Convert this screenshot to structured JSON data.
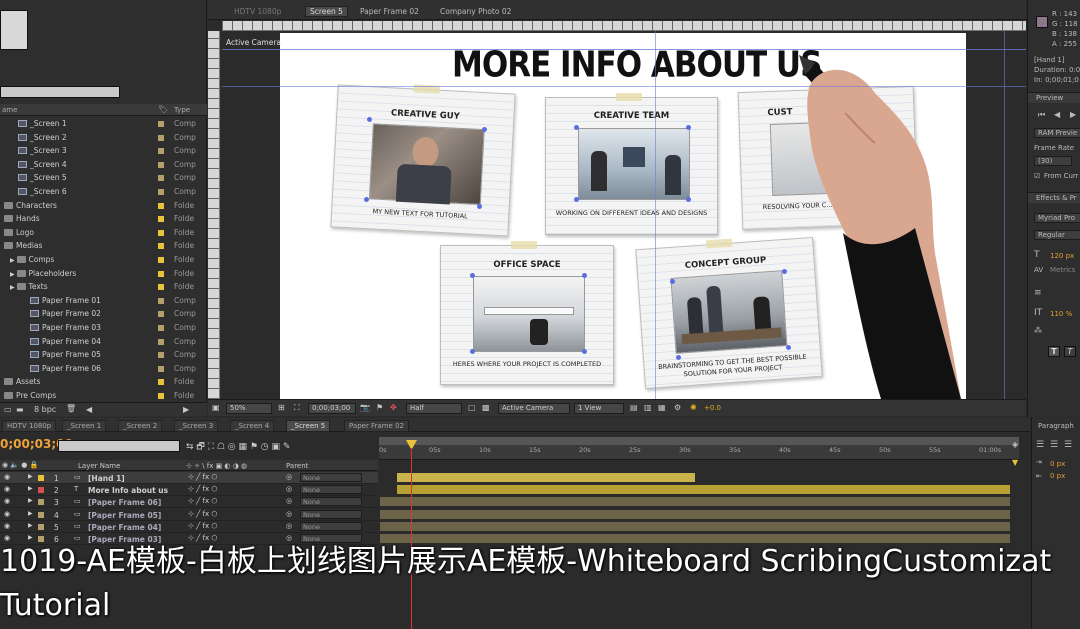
{
  "project": {
    "search_placeholder": "",
    "col_name": "ame",
    "col_type": "Type",
    "footer_bpc": "8 bpc",
    "items": [
      {
        "label": "_Screen 1",
        "kind": "comp",
        "indent": 2,
        "type": "Comp",
        "color": "#b3a06a"
      },
      {
        "label": "_Screen 2",
        "kind": "comp",
        "indent": 2,
        "type": "Comp",
        "color": "#b3a06a"
      },
      {
        "label": "_Screen 3",
        "kind": "comp",
        "indent": 2,
        "type": "Comp",
        "color": "#b3a06a"
      },
      {
        "label": "_Screen 4",
        "kind": "comp",
        "indent": 2,
        "type": "Comp",
        "color": "#b3a06a"
      },
      {
        "label": "_Screen 5",
        "kind": "comp",
        "indent": 2,
        "type": "Comp",
        "color": "#b3a06a"
      },
      {
        "label": "_Screen 6",
        "kind": "comp",
        "indent": 2,
        "type": "Comp",
        "color": "#b3a06a"
      },
      {
        "label": "Characters",
        "kind": "folder",
        "indent": 0,
        "type": "Folde",
        "color": "#e8c23a"
      },
      {
        "label": "Hands",
        "kind": "folder",
        "indent": 0,
        "type": "Folde",
        "color": "#e8c23a"
      },
      {
        "label": "Logo",
        "kind": "folder",
        "indent": 0,
        "type": "Folde",
        "color": "#e8c23a"
      },
      {
        "label": "Medias",
        "kind": "folder",
        "indent": 0,
        "type": "Folde",
        "color": "#e8c23a"
      },
      {
        "label": "Comps",
        "kind": "folder",
        "indent": 1,
        "type": "Folde",
        "color": "#e8c23a"
      },
      {
        "label": "Placeholders",
        "kind": "folder",
        "indent": 1,
        "type": "Folde",
        "color": "#e8c23a"
      },
      {
        "label": "Texts",
        "kind": "folder",
        "indent": 1,
        "type": "Folde",
        "color": "#e8c23a"
      },
      {
        "label": "Paper Frame 01",
        "kind": "comp",
        "indent": 3,
        "type": "Comp",
        "color": "#b3a06a"
      },
      {
        "label": "Paper Frame 02",
        "kind": "comp",
        "indent": 3,
        "type": "Comp",
        "color": "#b3a06a"
      },
      {
        "label": "Paper Frame 03",
        "kind": "comp",
        "indent": 3,
        "type": "Comp",
        "color": "#b3a06a"
      },
      {
        "label": "Paper Frame 04",
        "kind": "comp",
        "indent": 3,
        "type": "Comp",
        "color": "#b3a06a"
      },
      {
        "label": "Paper Frame 05",
        "kind": "comp",
        "indent": 3,
        "type": "Comp",
        "color": "#b3a06a"
      },
      {
        "label": "Paper Frame 06",
        "kind": "comp",
        "indent": 3,
        "type": "Comp",
        "color": "#b3a06a"
      },
      {
        "label": "Assets",
        "kind": "folder",
        "indent": 0,
        "type": "Folde",
        "color": "#e8c23a"
      },
      {
        "label": "Pre Comps",
        "kind": "folder",
        "indent": 0,
        "type": "Folde",
        "color": "#e8c23a"
      }
    ]
  },
  "viewer": {
    "tabs": [
      "HDTV 1080p",
      "Screen 5",
      "Paper Frame 02",
      "Company Photo 02"
    ],
    "active_tab": "Screen 5",
    "active_camera_label": "Active Camera",
    "canvas_title": "MORE INFO ABOUT US",
    "cards": [
      {
        "title": "CREATIVE GUY",
        "caption": "MY NEW TEXT FOR TUTORIAL"
      },
      {
        "title": "CREATIVE TEAM",
        "caption": "WORKING ON DIFFERENT IDEAS AND DESIGNS"
      },
      {
        "title": "CUST",
        "caption": "RESOLVING YOUR C... AND TAKING CARE OF..."
      },
      {
        "title": "OFFICE SPACE",
        "caption": "HERES WHERE YOUR PROJECT IS COMPLETED"
      },
      {
        "title": "CONCEPT GROUP",
        "caption": "BRAINSTORMING TO GET THE BEST POSSIBLE SOLUTION FOR YOUR PROJECT"
      }
    ],
    "zoom": "50%",
    "timecode": "0;00;03;00",
    "resolution": "Half",
    "camera": "Active Camera",
    "views": "1 View",
    "exposure": "+0.0"
  },
  "right_panel": {
    "info_r": "R : 143",
    "info_g": "G : 118",
    "info_b": "B : 138",
    "info_a": "A : 255",
    "layer_name": "[Hand 1]",
    "duration": "Duration: 0:0",
    "in_point": "In: 0;00;01;0",
    "preview_label": "Preview",
    "ram_preview": "RAM Previe",
    "frame_rate_label": "Frame Rate",
    "frame_rate": "(30)",
    "from_current": "From Curr",
    "effects_label": "Effects & Pr",
    "font": "Myriad Pro",
    "font_style": "Regular",
    "font_size": "120 px",
    "metrics": "Metrics",
    "leading": "110 %",
    "paragraph_label": "Paragraph",
    "px1": "0 px",
    "px2": "0 px"
  },
  "timeline": {
    "tabs": [
      "HDTV 1080p",
      "_Screen 1",
      "_Screen 2",
      "_Screen 3",
      "_Screen 4",
      "_Screen 5",
      "Paper Frame 02"
    ],
    "active_tab": "_Screen 5",
    "timecode": "0;00;03;00",
    "col_layer_name": "Layer Name",
    "col_parent": "Parent",
    "ticks": [
      "0s",
      "05s",
      "10s",
      "15s",
      "20s",
      "25s",
      "30s",
      "35s",
      "40s",
      "45s",
      "50s",
      "55s",
      "01:00s"
    ],
    "layers": [
      {
        "num": "1",
        "name": "[Hand 1]",
        "parent": "None",
        "color": "#e8c23a",
        "bar_color": "#c9b34a",
        "bar_start": 0.5,
        "bar_end": 3.0
      },
      {
        "num": "2",
        "name": "More Info about us",
        "parent": "None",
        "color": "#d94f4f",
        "bar_color": "#b8a133",
        "bar_start": 0.5,
        "bar_end": 6.2
      },
      {
        "num": "3",
        "name": "[Paper Frame 06]",
        "parent": "None",
        "color": "#b3a06a",
        "bar_color": "#6b6448",
        "bar_start": 0.0,
        "bar_end": 6.2
      },
      {
        "num": "4",
        "name": "[Paper Frame 05]",
        "parent": "None",
        "color": "#b3a06a",
        "bar_color": "#6b6448",
        "bar_start": 0.0,
        "bar_end": 6.2
      },
      {
        "num": "5",
        "name": "[Paper Frame 04]",
        "parent": "None",
        "color": "#b3a06a",
        "bar_color": "#6b6448",
        "bar_start": 0.0,
        "bar_end": 6.2
      },
      {
        "num": "6",
        "name": "[Paper Frame 03]",
        "parent": "None",
        "color": "#b3a06a",
        "bar_color": "#6b6448",
        "bar_start": 0.0,
        "bar_end": 6.2
      }
    ]
  },
  "overlay": {
    "line1": "1019-AE模板-白板上划线图片展示AE模板-Whiteboard ScribingCustomizat",
    "line2": "Tutorial"
  }
}
